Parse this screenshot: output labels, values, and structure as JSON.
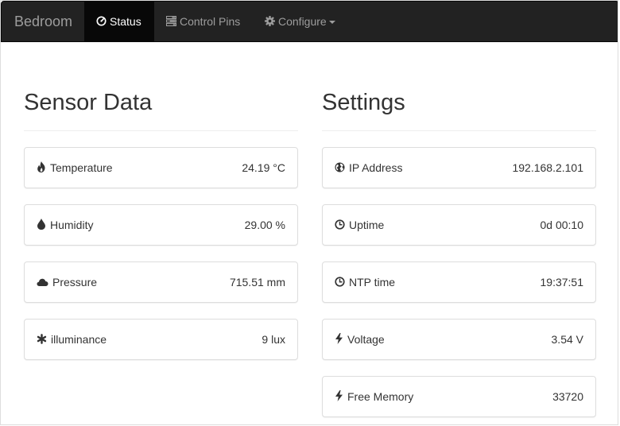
{
  "navbar": {
    "brand": "Bedroom",
    "items": [
      {
        "label": "Status",
        "icon": "dashboard-icon",
        "active": true
      },
      {
        "label": "Control Pins",
        "icon": "tasks-icon"
      },
      {
        "label": "Configure",
        "icon": "cog-icon",
        "dropdown": true
      }
    ]
  },
  "sensor": {
    "title": "Sensor Data",
    "rows": [
      {
        "label": "Temperature",
        "value": "24.19 °C",
        "icon": "fire-icon"
      },
      {
        "label": "Humidity",
        "value": "29.00 %",
        "icon": "tint-icon"
      },
      {
        "label": "Pressure",
        "value": "715.51 mm",
        "icon": "cloud-icon"
      },
      {
        "label": "illuminance",
        "value": "9 lux",
        "icon": "asterisk-icon"
      }
    ]
  },
  "settings": {
    "title": "Settings",
    "rows": [
      {
        "label": "IP Address",
        "value": "192.168.2.101",
        "icon": "globe-icon"
      },
      {
        "label": "Uptime",
        "value": "0d 00:10",
        "icon": "clock-icon"
      },
      {
        "label": "NTP time",
        "value": "19:37:51",
        "icon": "clock-icon"
      },
      {
        "label": "Voltage",
        "value": "3.54 V",
        "icon": "flash-icon"
      },
      {
        "label": "Free Memory",
        "value": "33720",
        "icon": "flash-icon"
      }
    ]
  },
  "colors": {
    "navbar_bg": "#222222",
    "navbar_active_bg": "#080808",
    "navbar_text": "#9d9d9d",
    "text": "#333333",
    "border": "#dddddd"
  }
}
